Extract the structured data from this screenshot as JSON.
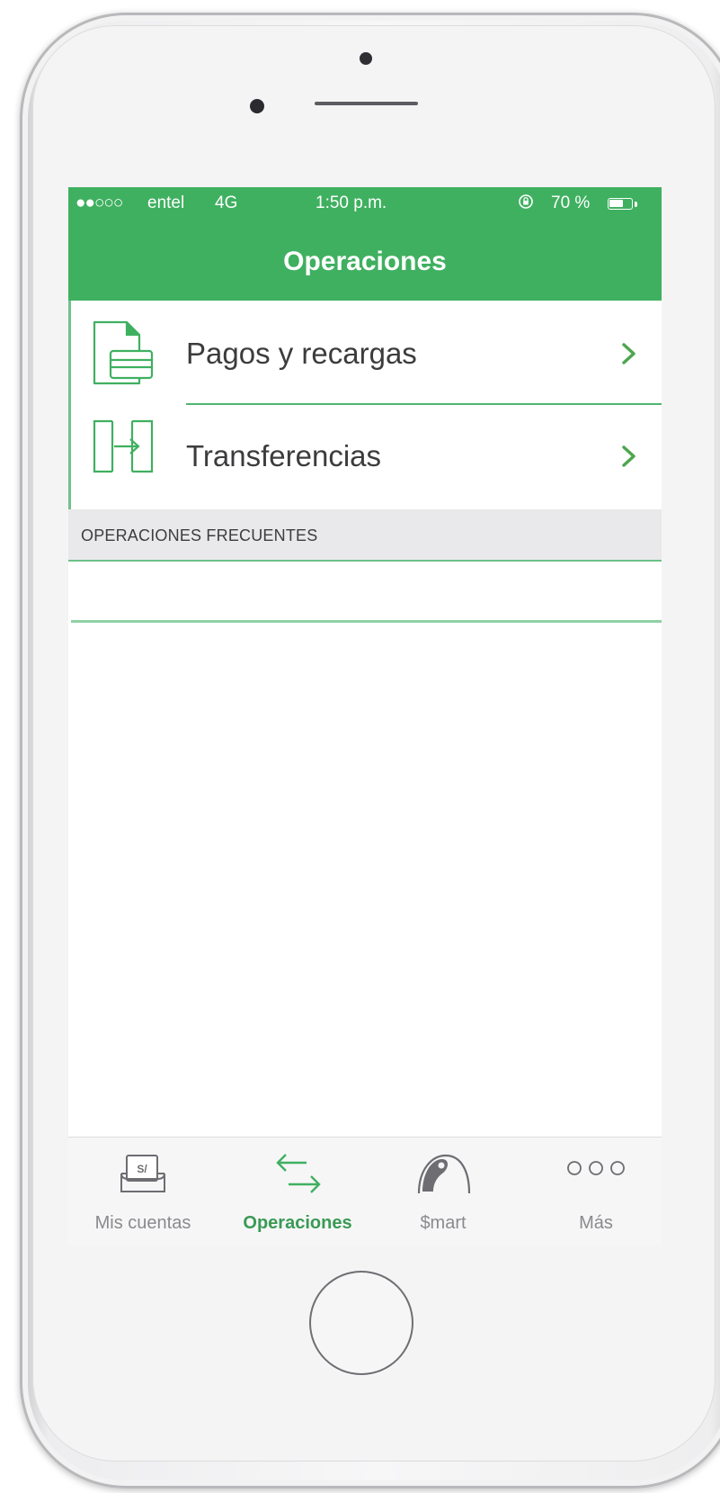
{
  "status_bar": {
    "signal": "●●○○○",
    "carrier": "entel",
    "network": "4G",
    "time": "1:50 p.m.",
    "lock_icon": "rotation-lock-icon",
    "battery_text": "70 %",
    "battery_level": 0.7
  },
  "nav": {
    "title": "Operaciones"
  },
  "menu": {
    "items": [
      {
        "label": "Pagos y recargas",
        "icon": "payment-document-icon"
      },
      {
        "label": "Transferencias",
        "icon": "transfer-arrow-icon"
      }
    ]
  },
  "section": {
    "title": "OPERACIONES FRECUENTES"
  },
  "tabs": [
    {
      "label": "Mis cuentas",
      "icon": "wallet-icon",
      "active": false
    },
    {
      "label": "Operaciones",
      "icon": "exchange-arrows-icon",
      "active": true
    },
    {
      "label": "$mart",
      "icon": "piggy-icon",
      "active": false
    },
    {
      "label": "Más",
      "icon": "more-dots-icon",
      "active": false
    }
  ],
  "colors": {
    "brand_green": "#3fb060",
    "active_tab": "#3a9a54",
    "inactive_tab": "#8a8a8e"
  }
}
